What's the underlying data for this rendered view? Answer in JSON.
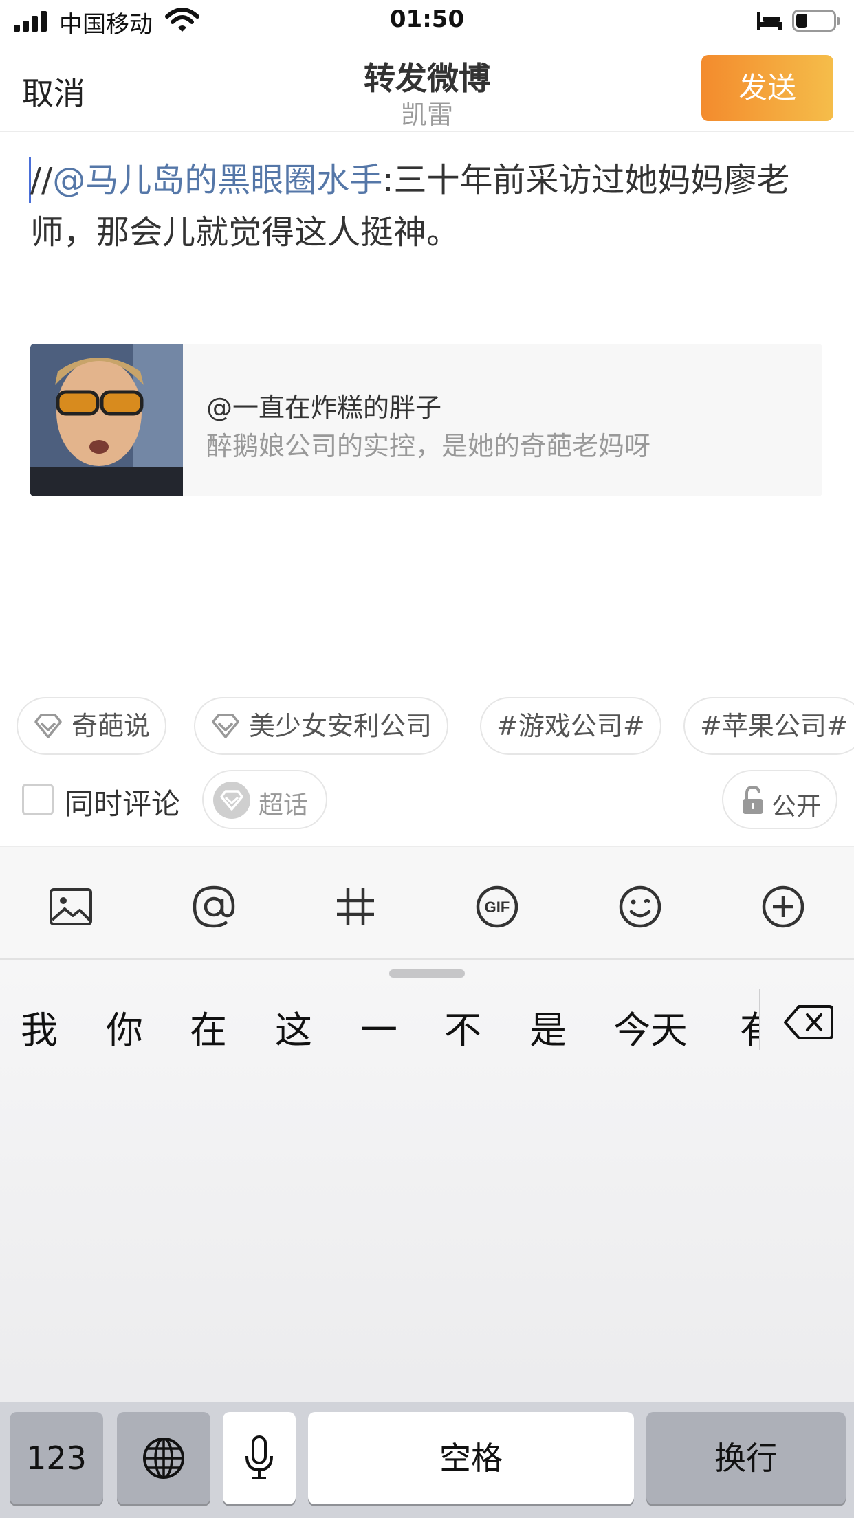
{
  "status_bar": {
    "carrier": "中国移动",
    "time": "01:50",
    "battery_level": 0.3
  },
  "nav": {
    "cancel_label": "取消",
    "title": "转发微博",
    "subtitle": "凯雷",
    "send_label": "发送"
  },
  "compose": {
    "prefix": "//",
    "mention": "@马儿岛的黑眼圈水手",
    "text": ":三十年前采访过她妈妈廖老师，那会儿就觉得这人挺神。"
  },
  "quoted_post": {
    "user": "@一直在炸糕的胖子",
    "text": "醉鹅娘公司的实控，是她的奇葩老妈呀"
  },
  "topics": [
    {
      "label": "奇葩说",
      "icon": "diamond-icon"
    },
    {
      "label": "美少女安利公司",
      "icon": "diamond-icon"
    },
    {
      "label": "#游戏公司#"
    },
    {
      "label": "#苹果公司#"
    }
  ],
  "options": {
    "comment_also_label": "同时评论",
    "super_topic_label": "超话",
    "visibility_label": "公开"
  },
  "toolbar": {
    "icons": [
      "image-icon",
      "at-icon",
      "hashtag-icon",
      "gif-icon",
      "emoji-icon",
      "plus-icon"
    ]
  },
  "keyboard": {
    "candidates": [
      "我",
      "你",
      "在",
      "这",
      "一",
      "不",
      "是",
      "今天",
      "有"
    ],
    "keys": {
      "numbers": "123",
      "space": "空格",
      "return": "换行"
    }
  }
}
